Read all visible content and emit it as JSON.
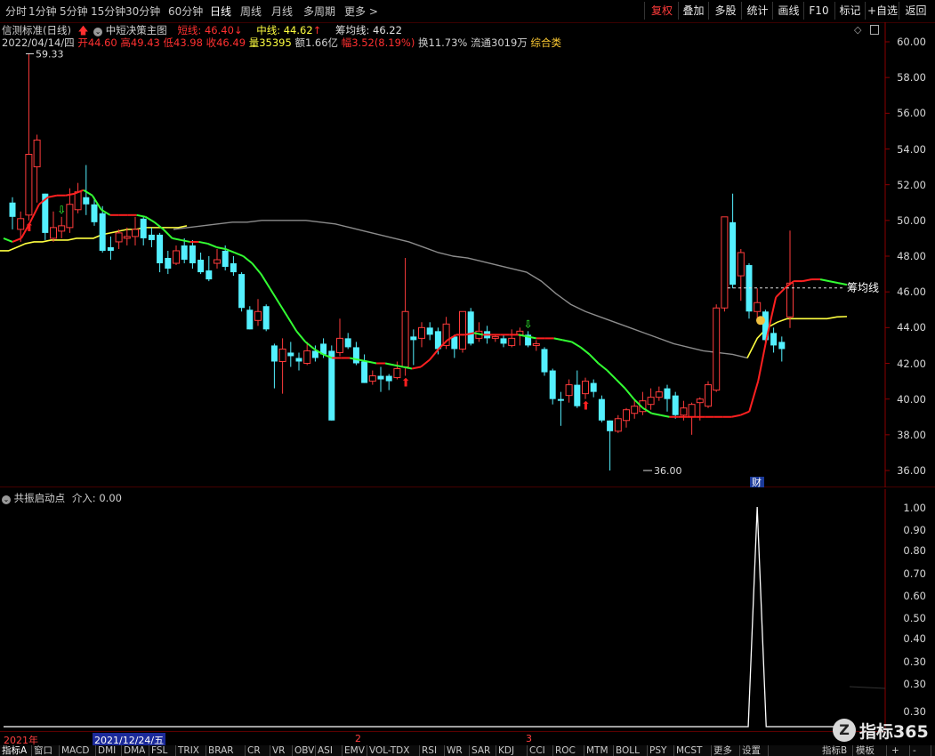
{
  "toolbar": {
    "periods": [
      "分时",
      "1分钟",
      "5分钟",
      "15分钟",
      "30分钟",
      "60分钟",
      "日线",
      "周线",
      "月线",
      "多周期",
      "更多 >"
    ],
    "active_period": "日线",
    "right_buttons": [
      "复权",
      "叠加",
      "多股",
      "统计",
      "画线",
      "F10",
      "标记",
      "+自选",
      "返回"
    ]
  },
  "indicator_header": {
    "name": "信测标准(日线)",
    "template": "中短决策主图",
    "short_label": "短线:",
    "short_value": "46.40",
    "mid_label": "中线:",
    "mid_value": "44.62",
    "chip_label": "筹均线:",
    "chip_value": "46.22"
  },
  "quote_line": {
    "date": "2022/04/14/四",
    "open_label": "开",
    "open": "44.60",
    "high_label": "高",
    "high": "49.43",
    "low_label": "低",
    "low": "43.98",
    "close_label": "收",
    "close": "46.49",
    "volume_label": "量",
    "volume": "35395",
    "amount_label": "额",
    "amount": "1.66亿",
    "change_label": "幅",
    "change": "3.52(8.19%)",
    "turnover_label": "换",
    "turnover": "11.73%",
    "float_label": "流通",
    "float": "3019万",
    "category": "综合类"
  },
  "main_chart": {
    "y_ticks": [
      "60.00",
      "58.00",
      "56.00",
      "54.00",
      "52.00",
      "50.00",
      "48.00",
      "46.00",
      "44.00",
      "42.00",
      "40.00",
      "38.00",
      "36.00"
    ],
    "y_min": 35.2,
    "y_max": 60.8,
    "max_label": "59.33",
    "min_label": "36.00",
    "chip_line_label": "筹均线",
    "finance_marker": "财",
    "colors": {
      "up": "#ff3b3b",
      "down": "#54f0ff",
      "short_line_up": "#ff2020",
      "short_line_down": "#33ff33",
      "mid_line": "#ffff40",
      "chip_line": "#8c8c8c"
    }
  },
  "sub_chart": {
    "title": "共振启动点",
    "value_label": "介入:",
    "value": "0.00",
    "y_ticks": [
      "1.00",
      "0.90",
      "0.80",
      "0.70",
      "0.60",
      "0.50",
      "0.40",
      "0.30",
      "0.30",
      "0.30"
    ]
  },
  "chart_data": {
    "type": "candlestick",
    "title": "信测标准(日线)",
    "ylim": [
      35.2,
      60.8
    ],
    "candles": [
      {
        "o": 51.0,
        "c": 50.2,
        "h": 51.3,
        "l": 49.5
      },
      {
        "o": 49.5,
        "c": 50.1,
        "h": 50.5,
        "l": 48.8
      },
      {
        "o": 50.3,
        "c": 53.7,
        "h": 59.33,
        "l": 50.0
      },
      {
        "o": 53.0,
        "c": 54.5,
        "h": 54.8,
        "l": 51.0
      },
      {
        "o": 51.5,
        "c": 49.3,
        "h": 51.5,
        "l": 48.9
      },
      {
        "o": 49.0,
        "c": 49.6,
        "h": 50.5,
        "l": 48.8
      },
      {
        "o": 49.4,
        "c": 49.7,
        "h": 50.2,
        "l": 49.0
      },
      {
        "o": 49.6,
        "c": 50.9,
        "h": 51.8,
        "l": 49.3
      },
      {
        "o": 50.6,
        "c": 51.6,
        "h": 52.1,
        "l": 50.4
      },
      {
        "o": 51.3,
        "c": 50.9,
        "h": 53.1,
        "l": 50.3
      },
      {
        "o": 50.9,
        "c": 49.9,
        "h": 51.3,
        "l": 49.7
      },
      {
        "o": 50.4,
        "c": 48.3,
        "h": 50.8,
        "l": 48.2
      },
      {
        "o": 48.5,
        "c": 48.3,
        "h": 49.1,
        "l": 47.8
      },
      {
        "o": 48.8,
        "c": 49.3,
        "h": 49.5,
        "l": 48.4
      },
      {
        "o": 49.0,
        "c": 49.1,
        "h": 49.6,
        "l": 48.6
      },
      {
        "o": 49.1,
        "c": 49.5,
        "h": 50.2,
        "l": 48.6
      },
      {
        "o": 50.1,
        "c": 49.0,
        "h": 50.2,
        "l": 48.6
      },
      {
        "o": 49.2,
        "c": 48.9,
        "h": 49.6,
        "l": 48.5
      },
      {
        "o": 49.2,
        "c": 47.6,
        "h": 49.3,
        "l": 47.1
      },
      {
        "o": 47.9,
        "c": 47.3,
        "h": 48.3,
        "l": 47.0
      },
      {
        "o": 47.6,
        "c": 48.3,
        "h": 48.6,
        "l": 47.5
      },
      {
        "o": 48.6,
        "c": 47.8,
        "h": 49.0,
        "l": 47.6
      },
      {
        "o": 48.6,
        "c": 47.6,
        "h": 48.9,
        "l": 47.3
      },
      {
        "o": 47.8,
        "c": 47.1,
        "h": 48.2,
        "l": 47.0
      },
      {
        "o": 47.2,
        "c": 46.7,
        "h": 48.0,
        "l": 46.6
      },
      {
        "o": 47.6,
        "c": 47.8,
        "h": 48.4,
        "l": 47.3
      },
      {
        "o": 48.3,
        "c": 47.4,
        "h": 48.6,
        "l": 47.2
      },
      {
        "o": 47.6,
        "c": 47.1,
        "h": 48.0,
        "l": 46.9
      },
      {
        "o": 47.0,
        "c": 45.1,
        "h": 47.1,
        "l": 44.9
      },
      {
        "o": 45.0,
        "c": 43.9,
        "h": 45.2,
        "l": 43.9
      },
      {
        "o": 44.4,
        "c": 44.9,
        "h": 45.6,
        "l": 44.1
      },
      {
        "o": 45.2,
        "c": 43.9,
        "h": 45.3,
        "l": 43.8
      },
      {
        "o": 43.0,
        "c": 42.1,
        "h": 43.1,
        "l": 40.6
      },
      {
        "o": 42.1,
        "c": 42.8,
        "h": 43.4,
        "l": 40.3
      },
      {
        "o": 42.6,
        "c": 42.4,
        "h": 43.2,
        "l": 41.8
      },
      {
        "o": 42.3,
        "c": 42.1,
        "h": 42.6,
        "l": 41.6
      },
      {
        "o": 42.0,
        "c": 42.7,
        "h": 43.2,
        "l": 41.9
      },
      {
        "o": 42.7,
        "c": 42.3,
        "h": 43.0,
        "l": 42.1
      },
      {
        "o": 43.1,
        "c": 42.5,
        "h": 43.4,
        "l": 42.3
      },
      {
        "o": 42.7,
        "c": 38.8,
        "h": 43.0,
        "l": 38.8
      },
      {
        "o": 42.6,
        "c": 43.4,
        "h": 44.5,
        "l": 42.4
      },
      {
        "o": 43.4,
        "c": 42.9,
        "h": 43.7,
        "l": 42.8
      },
      {
        "o": 42.9,
        "c": 42.0,
        "h": 43.2,
        "l": 41.9
      },
      {
        "o": 42.1,
        "c": 40.9,
        "h": 42.5,
        "l": 40.9
      },
      {
        "o": 41.0,
        "c": 41.3,
        "h": 41.6,
        "l": 40.8
      },
      {
        "o": 41.3,
        "c": 41.1,
        "h": 41.8,
        "l": 40.4
      },
      {
        "o": 41.3,
        "c": 41.0,
        "h": 41.4,
        "l": 40.5
      },
      {
        "o": 41.2,
        "c": 41.7,
        "h": 42.1,
        "l": 41.1
      },
      {
        "o": 41.8,
        "c": 44.9,
        "h": 47.9,
        "l": 41.3
      },
      {
        "o": 43.5,
        "c": 43.3,
        "h": 43.9,
        "l": 41.9
      },
      {
        "o": 43.4,
        "c": 44.0,
        "h": 44.3,
        "l": 42.9
      },
      {
        "o": 44.0,
        "c": 43.6,
        "h": 44.3,
        "l": 43.3
      },
      {
        "o": 43.8,
        "c": 42.8,
        "h": 44.0,
        "l": 42.5
      },
      {
        "o": 43.0,
        "c": 44.2,
        "h": 44.6,
        "l": 42.8
      },
      {
        "o": 43.5,
        "c": 42.8,
        "h": 43.6,
        "l": 42.3
      },
      {
        "o": 42.8,
        "c": 44.9,
        "h": 44.9,
        "l": 42.6
      },
      {
        "o": 44.9,
        "c": 43.1,
        "h": 45.1,
        "l": 43.0
      },
      {
        "o": 43.4,
        "c": 43.8,
        "h": 44.3,
        "l": 43.2
      },
      {
        "o": 43.8,
        "c": 43.4,
        "h": 44.1,
        "l": 43.1
      },
      {
        "o": 43.4,
        "c": 43.5,
        "h": 43.6,
        "l": 43.2
      },
      {
        "o": 43.4,
        "c": 43.1,
        "h": 43.6,
        "l": 42.9
      },
      {
        "o": 43.0,
        "c": 43.4,
        "h": 43.9,
        "l": 42.9
      },
      {
        "o": 43.6,
        "c": 43.8,
        "h": 44.0,
        "l": 43.0
      },
      {
        "o": 43.6,
        "c": 43.0,
        "h": 43.8,
        "l": 42.9
      },
      {
        "o": 43.0,
        "c": 43.1,
        "h": 43.3,
        "l": 42.7
      },
      {
        "o": 42.8,
        "c": 41.5,
        "h": 42.9,
        "l": 41.3
      },
      {
        "o": 41.6,
        "c": 40.0,
        "h": 41.7,
        "l": 39.7
      },
      {
        "o": 40.0,
        "c": 39.9,
        "h": 40.4,
        "l": 38.5
      },
      {
        "o": 40.2,
        "c": 40.8,
        "h": 41.1,
        "l": 39.8
      },
      {
        "o": 40.8,
        "c": 39.6,
        "h": 41.6,
        "l": 39.5
      },
      {
        "o": 40.3,
        "c": 41.0,
        "h": 41.2,
        "l": 40.0
      },
      {
        "o": 40.9,
        "c": 40.4,
        "h": 41.1,
        "l": 40.1
      },
      {
        "o": 40.0,
        "c": 38.8,
        "h": 40.2,
        "l": 38.7
      },
      {
        "o": 38.8,
        "c": 38.2,
        "h": 38.8,
        "l": 36.0
      },
      {
        "o": 38.2,
        "c": 38.9,
        "h": 39.1,
        "l": 38.1
      },
      {
        "o": 38.8,
        "c": 39.4,
        "h": 39.5,
        "l": 38.4
      },
      {
        "o": 39.2,
        "c": 39.6,
        "h": 40.0,
        "l": 38.9
      },
      {
        "o": 39.3,
        "c": 39.9,
        "h": 40.4,
        "l": 39.1
      },
      {
        "o": 39.7,
        "c": 40.1,
        "h": 40.6,
        "l": 39.4
      },
      {
        "o": 40.1,
        "c": 40.4,
        "h": 40.7,
        "l": 39.9
      },
      {
        "o": 40.6,
        "c": 40.0,
        "h": 40.8,
        "l": 39.3
      },
      {
        "o": 40.2,
        "c": 39.1,
        "h": 40.4,
        "l": 38.9
      },
      {
        "o": 39.1,
        "c": 39.5,
        "h": 39.9,
        "l": 38.8
      },
      {
        "o": 39.0,
        "c": 39.7,
        "h": 39.8,
        "l": 38.0
      },
      {
        "o": 39.8,
        "c": 40.0,
        "h": 40.1,
        "l": 38.8
      },
      {
        "o": 39.6,
        "c": 40.8,
        "h": 41.0,
        "l": 39.5
      },
      {
        "o": 40.5,
        "c": 45.1,
        "h": 45.3,
        "l": 40.4
      },
      {
        "o": 45.1,
        "c": 50.2,
        "h": 50.2,
        "l": 44.9
      },
      {
        "o": 49.9,
        "c": 46.4,
        "h": 51.5,
        "l": 46.2
      },
      {
        "o": 46.9,
        "c": 48.2,
        "h": 48.4,
        "l": 45.5
      },
      {
        "o": 47.5,
        "c": 44.9,
        "h": 47.6,
        "l": 44.5
      },
      {
        "o": 44.9,
        "c": 45.4,
        "h": 46.2,
        "l": 44.3
      },
      {
        "o": 44.9,
        "c": 43.3,
        "h": 45.0,
        "l": 43.2
      },
      {
        "o": 43.7,
        "c": 43.0,
        "h": 44.0,
        "l": 42.6
      },
      {
        "o": 43.2,
        "c": 42.8,
        "h": 43.5,
        "l": 42.1
      },
      {
        "o": 44.6,
        "c": 46.49,
        "h": 49.43,
        "l": 43.98
      }
    ],
    "series_short": [
      49.0,
      48.8,
      49.0,
      49.9,
      50.9,
      51.3,
      51.4,
      51.4,
      51.5,
      51.7,
      51.4,
      50.6,
      50.3,
      50.3,
      50.3,
      50.3,
      50.2,
      49.9,
      49.5,
      49.0,
      48.9,
      48.8,
      48.8,
      48.7,
      48.5,
      48.4,
      48.2,
      48.0,
      47.6,
      47.0,
      46.2,
      45.4,
      44.6,
      43.8,
      43.2,
      42.8,
      42.5,
      42.3,
      42.3,
      42.3,
      42.2,
      42.1,
      42.0,
      42.0,
      41.9,
      41.8,
      41.7,
      41.8,
      42.2,
      42.8,
      43.3,
      43.6,
      43.6,
      43.7,
      43.6,
      43.6,
      43.6,
      43.6,
      43.6,
      43.5,
      43.4,
      43.4,
      43.4,
      43.3,
      43.2,
      42.9,
      42.5,
      42.0,
      41.6,
      41.1,
      40.6,
      40.0,
      39.5,
      39.2,
      39.1,
      39.0,
      39.0,
      39.0,
      39.0,
      39.0,
      39.0,
      39.0,
      39.0,
      39.1,
      39.3,
      41.0,
      43.5,
      45.7,
      46.2,
      46.6,
      46.6,
      46.7,
      46.7,
      46.6,
      46.5,
      46.4
    ],
    "series_mid": [
      48.3,
      48.3,
      48.5,
      48.7,
      48.8,
      48.8,
      48.9,
      48.9,
      48.9,
      49.0,
      49.0,
      49.0,
      49.2,
      49.3,
      49.4,
      49.5,
      49.5,
      49.6,
      49.6,
      49.6,
      49.6,
      49.6,
      49.7
    ],
    "mid_start_index": 0,
    "series_mid_right": [
      42.3,
      43.4,
      44.0,
      44.3,
      44.5,
      44.5,
      44.5,
      44.5,
      44.5,
      44.6,
      44.62
    ],
    "series_chip": [
      49.5,
      49.6,
      49.7,
      49.8,
      49.9,
      49.9,
      50.0,
      50.0,
      50.0,
      50.0,
      49.9,
      49.8,
      49.6,
      49.4,
      49.2,
      49.0,
      48.8,
      48.5,
      48.2,
      48.0,
      47.9,
      47.7,
      47.5,
      47.3,
      47.1,
      46.6,
      45.9,
      45.3,
      44.9,
      44.6,
      44.3,
      44.0,
      43.7,
      43.4,
      43.1,
      42.9,
      42.7,
      42.6,
      42.5,
      42.3
    ],
    "chip_start_index": 19,
    "signal_arrows_up": [
      2,
      48,
      70
    ],
    "signal_arrows_down": [
      6,
      63
    ],
    "sub_values": [
      0,
      0,
      0,
      0,
      0,
      0,
      0,
      0,
      0,
      0,
      0,
      0,
      0,
      0,
      0,
      0,
      0,
      0,
      0,
      0,
      0,
      0,
      0,
      0,
      0,
      0,
      0,
      0,
      0,
      0,
      0,
      0,
      0,
      0,
      0,
      0,
      0,
      0,
      0,
      0,
      0,
      0,
      0,
      0,
      0,
      0,
      0,
      0,
      0,
      0,
      0,
      0,
      0,
      0,
      0,
      0,
      0,
      0,
      0,
      0,
      0,
      0,
      0,
      0,
      0,
      0,
      0,
      0,
      0,
      0,
      0,
      0,
      0,
      0,
      0,
      0,
      0,
      0,
      0,
      0,
      0,
      0,
      0,
      0,
      1,
      0,
      0,
      0,
      0,
      0,
      0,
      0,
      0,
      0,
      0
    ]
  },
  "time_axis": {
    "labels": [
      "2021年",
      "2021/12/24/五",
      "2",
      "3"
    ]
  },
  "bottom_tabs": [
    "指标A",
    "窗口",
    "MACD",
    "DMI",
    "DMA",
    "FSL",
    "TRIX",
    "BRAR",
    "CR",
    "VR",
    "OBV",
    "ASI",
    "EMV",
    "VOL-TDX",
    "RSI",
    "WR",
    "SAR",
    "KDJ",
    "CCI",
    "ROC",
    "MTM",
    "BOLL",
    "PSY",
    "MCST",
    "更多",
    "设置"
  ],
  "bottom_right_tabs": [
    "指标B",
    "模板",
    "+",
    "-"
  ],
  "watermark": "指标365"
}
